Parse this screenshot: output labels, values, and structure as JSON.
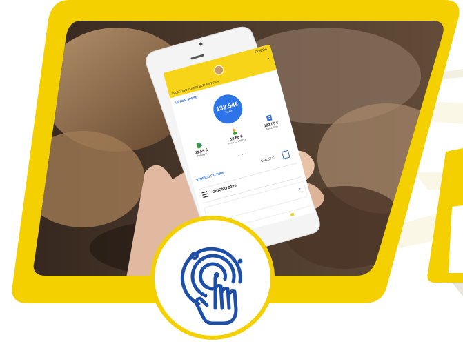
{
  "colors": {
    "brand_yellow": "#F5D000",
    "brand_blue": "#2D74E8",
    "icon_blue": "#1E4FA8",
    "background": "#FFFFFF"
  },
  "phone_screen": {
    "status_time": "ProEDo",
    "address": "TELEFONO ZUMIGI BLEVESTON 4",
    "section_title": "ULTIME SPESE",
    "total": {
      "value": "133,54€",
      "label": "Totale"
    },
    "categories": [
      {
        "value": "22,55 €",
        "label": "Pellegrin",
        "icon": "gas-icon"
      },
      {
        "value": "10,68 €",
        "label": "Aree C. Utilizza",
        "icon": "person-icon"
      },
      {
        "value": "122,00 €",
        "label": "Prod. Sop",
        "icon": "document-icon"
      }
    ],
    "pager_dots": "• • •",
    "history_title": "STORICO FATTURE",
    "history_amount": "546,67 €",
    "bill_month": "GIUGNO 2020",
    "chevron": "›"
  },
  "badge": {
    "icon": "touch-tap-icon"
  }
}
